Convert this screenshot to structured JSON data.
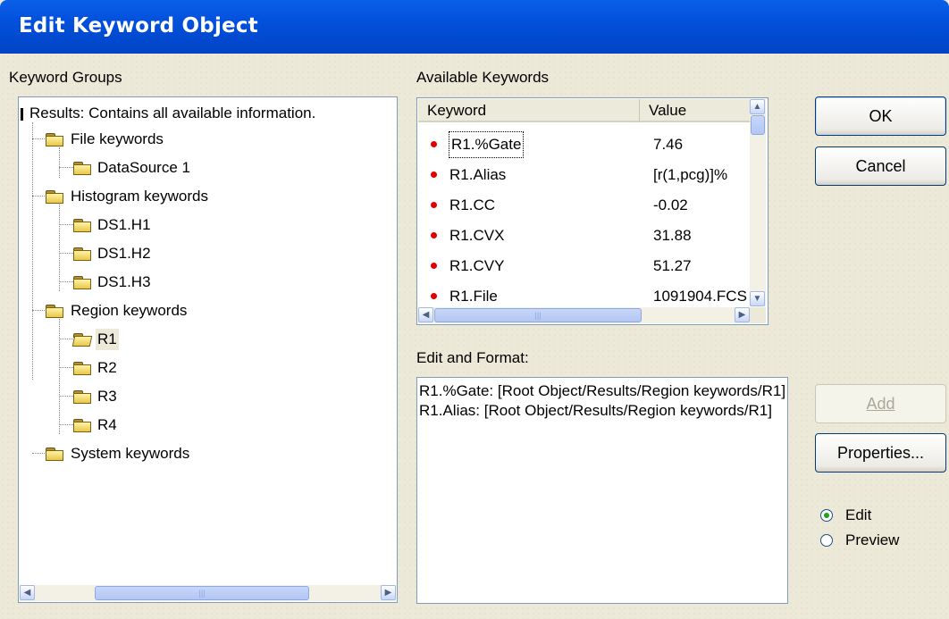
{
  "window": {
    "title": "Edit Keyword Object"
  },
  "groups": {
    "label": "Keyword Groups",
    "root": "Results: Contains all available information.",
    "file": "File keywords",
    "datasource1": "DataSource 1",
    "histogram": "Histogram keywords",
    "h1": "DS1.H1",
    "h2": "DS1.H2",
    "h3": "DS1.H3",
    "region": "Region keywords",
    "r1": "R1",
    "r2": "R2",
    "r3": "R3",
    "r4": "R4",
    "system": "System keywords"
  },
  "keywords": {
    "label": "Available Keywords",
    "col_keyword": "Keyword",
    "col_value": "Value",
    "rows": [
      {
        "keyword": "R1.%Gate",
        "value": "7.46"
      },
      {
        "keyword": "R1.Alias",
        "value": "[r(1,pcg)]%"
      },
      {
        "keyword": "R1.CC",
        "value": "-0.02"
      },
      {
        "keyword": "R1.CVX",
        "value": "31.88"
      },
      {
        "keyword": "R1.CVY",
        "value": "51.27"
      },
      {
        "keyword": "R1.File",
        "value": "1091904.FCS"
      }
    ]
  },
  "edit": {
    "label": "Edit and Format:",
    "line1": "R1.%Gate: [Root Object/Results/Region keywords/R1]",
    "line2": "R1.Alias: [Root Object/Results/Region keywords/R1]"
  },
  "buttons": {
    "ok": "OK",
    "cancel": "Cancel",
    "add": "Add",
    "properties": "Properties..."
  },
  "mode": {
    "edit": "Edit",
    "preview": "Preview",
    "selected": "Edit"
  },
  "colors": {
    "title_bar": "#0a5fe8",
    "face": "#ece9d8",
    "bullet": "#e00000",
    "border": "#7f9db9"
  }
}
